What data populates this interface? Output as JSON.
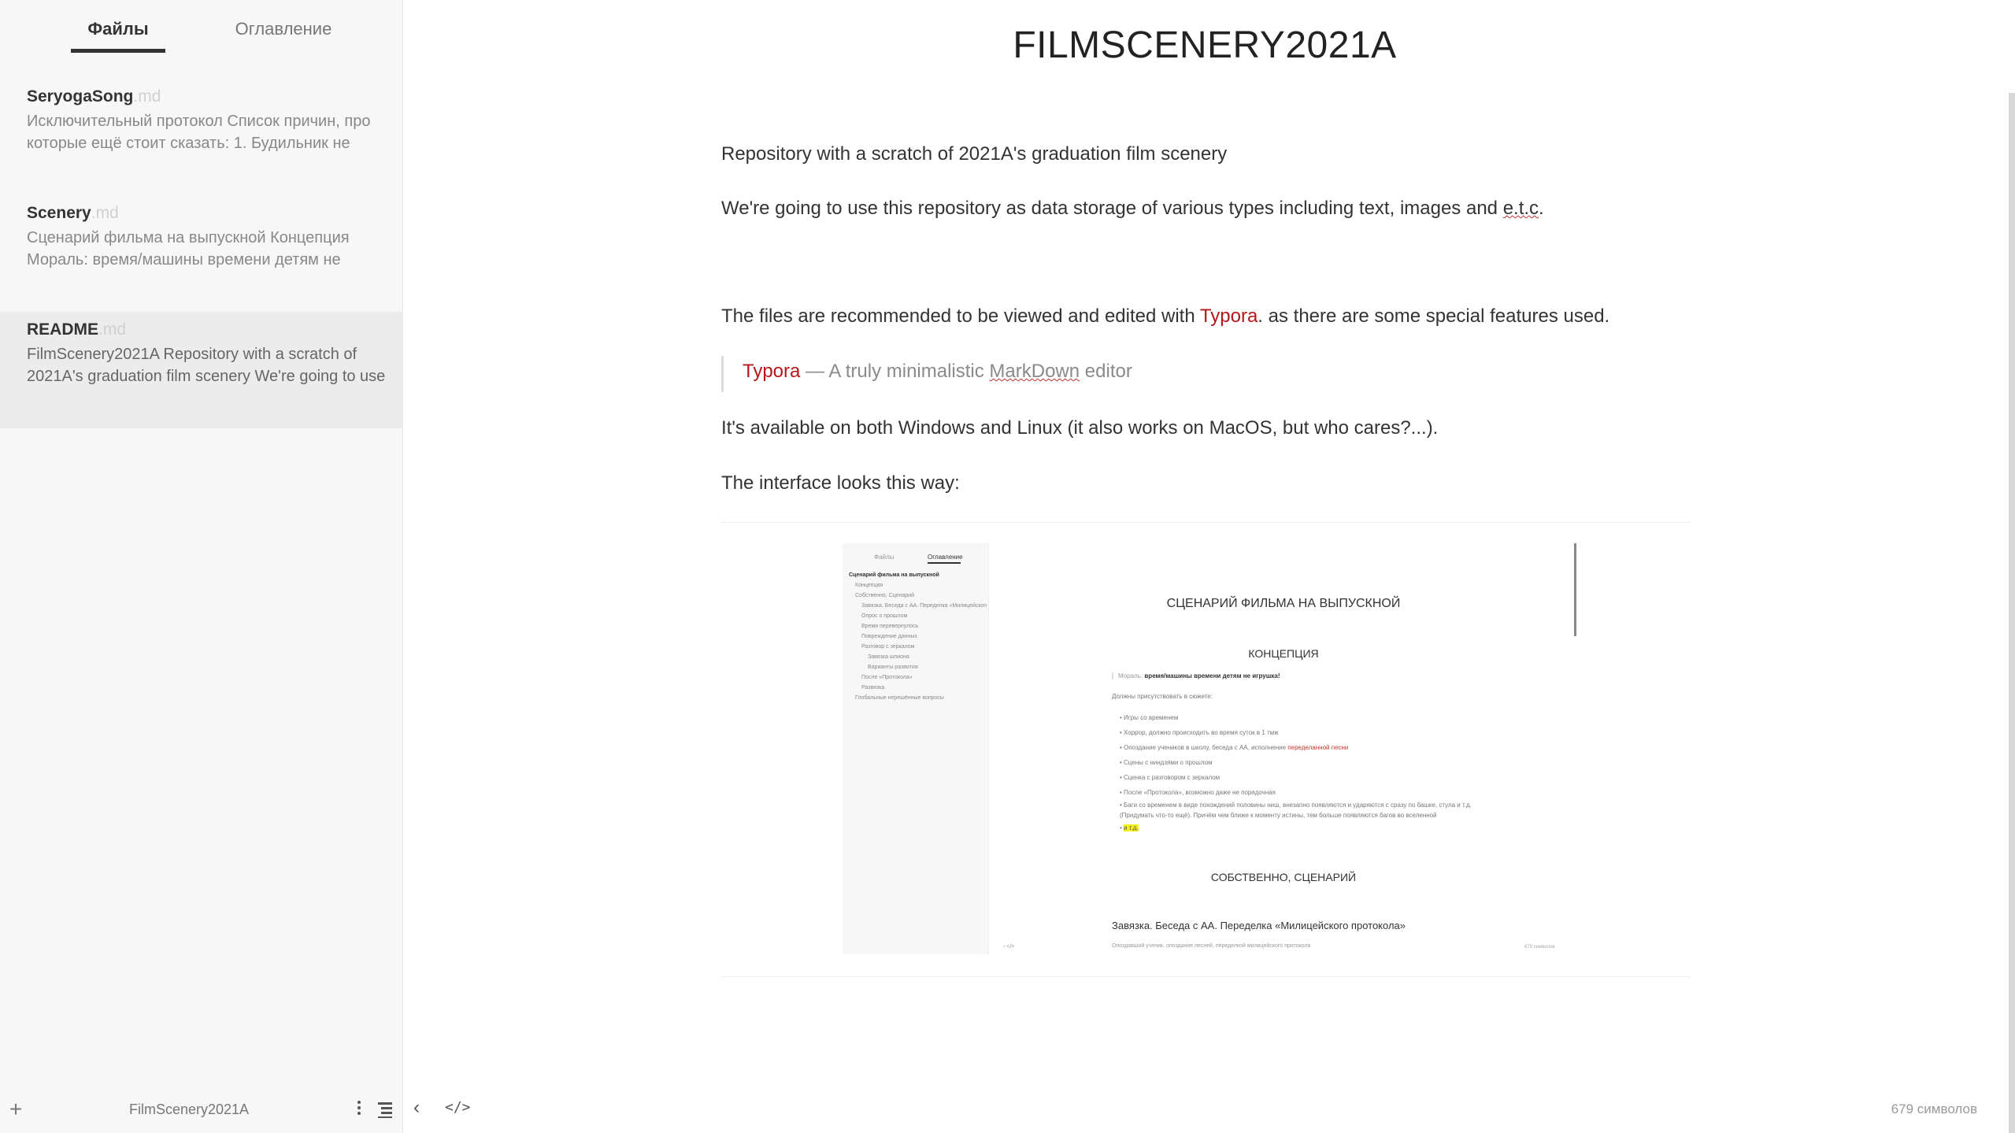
{
  "sidebar": {
    "tabs": {
      "files": "Файлы",
      "toc": "Оглавление"
    },
    "files": [
      {
        "name": "SeryogaSong",
        "ext": ".md",
        "snippet": "Исключительный протокол Список причин, про которые ещё стоит сказать: 1. Будильник не"
      },
      {
        "name": "Scenery",
        "ext": ".md",
        "snippet": "Сценарий фильма на выпускной Концепция Мораль: время/машины времени детям не"
      },
      {
        "name": "README",
        "ext": ".md",
        "snippet": "FilmScenery2021A Repository with a scratch of 2021A's graduation film scenery We're going to use"
      }
    ],
    "footer": {
      "add": "+",
      "folder": "FilmScenery2021A"
    }
  },
  "document": {
    "title": "FILMSCENERY2021A",
    "p1": "Repository with a scratch of 2021A's graduation film scenery",
    "p2_before": "We're going to use this repository as data storage of various types including text, images and ",
    "p2_etc": "e.t.c",
    "p2_after": ".",
    "p3_before": "The files are recommended to be viewed and edited with ",
    "p3_link": "Typora",
    "p3_after": ". as there are some special features used.",
    "quote_link": "Typora",
    "quote_mid": " — A truly minimalistic ",
    "quote_md": "MarkDown",
    "quote_after": " editor",
    "p4": "It's available on both Windows and Linux (it also works on MacOS, but who cares?...).",
    "p5": "The interface looks this way:"
  },
  "embedded": {
    "tabs": {
      "files": "Файлы",
      "toc": "Оглавление"
    },
    "toc": [
      "Сценарий фильма на выпускной",
      "Концепция",
      "Собственно, Сценарий",
      "Завязка. Беседа с АА. Переделка «Милицейского протокола»",
      "Опрос о прошлом",
      "Время перевернулось",
      "Повреждение данных",
      "Разговор с зеркалом",
      "Завязка шпионa",
      "Варианты развития",
      "После «Протокола»",
      "Развязка",
      "Глобальные нерешённые вопросы"
    ],
    "heading1": "СЦЕНАРИЙ ФИЛЬМА НА ВЫПУСКНОЙ",
    "heading2": "КОНЦЕПЦИЯ",
    "quote_label": "Мораль: ",
    "quote_text": "время/машины времени детям не игрушка!",
    "must_present": "Должны присутствовать в сюжете:",
    "list": [
      "Игры со временем",
      "Хоррор, должно происходить во время суток в 1 тмж",
      "Опоздание учеников в школу, беседа с АА, исполнение",
      "Сцены с ниндзями о прошлом",
      "Сценка с разговором с зеркалом",
      "После «Протокола», возможно даже не порядочная",
      "Баги со временем в виде похождений половины ниш, внезапно появляются и ударяются с сразу по башке, стула и т.д. (Придумать что-то ещё). Причём чем ближе к моменту истины, тем больше появляются багов во вселенной",
      "и т.д."
    ],
    "list_red_tail": "переделанной песни",
    "heading3": "СОБСТВЕННО, СЦЕНАРИЙ",
    "heading4": "Завязка. Беседа с АА. Переделка «Милицейского протокола»",
    "foot_text": "Опоздавший ученик, опоздание песней, переделкой милицейского протокола",
    "nav": "‹  </>",
    "count": "679 символов"
  },
  "footer": {
    "word_count": "679 символов"
  }
}
